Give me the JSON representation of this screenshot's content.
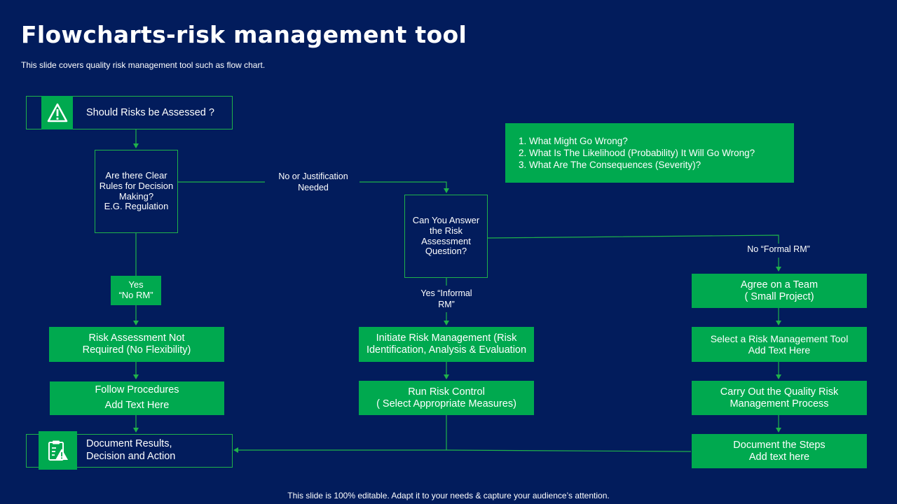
{
  "slide": {
    "title": "Flowcharts-risk management tool",
    "subtitle": "This slide covers quality risk management tool such as flow chart.",
    "footer": "This slide is 100% editable. Adapt it to your needs & capture your audience’s attention."
  },
  "flow": {
    "start": {
      "text": "Should Risks be Assessed ?",
      "icon": "warning-icon"
    },
    "rules_question": "Are there Clear\nRules for Decision\nMaking?\nE.G. Regulation",
    "no_justification_label": "No or Justification\nNeeded",
    "yes_no_rm": "Yes\n“No RM”",
    "risk_not_required": "Risk Assessment Not\nRequired (No Flexibility)",
    "follow_procedures": "Follow Procedures\nAdd Text Here",
    "document_results": {
      "text": "Document Results,\nDecision and Action",
      "icon": "clipboard-warning-icon"
    },
    "answer_question": "Can You Answer\nthe Risk\nAssessment\nQuestion?",
    "yes_informal_label": "Yes “Informal\nRM”",
    "initiate": "Initiate Risk Management (Risk\nIdentification, Analysis & Evaluation",
    "run_control": "Run Risk Control\n( Select Appropriate Measures)",
    "no_formal_label": "No “Formal RM”",
    "agree_team": "Agree on a Team\n( Small Project)",
    "select_tool": "Select a Risk Management Tool\nAdd Text Here",
    "carry_out": "Carry Out the Quality Risk\nManagement Process",
    "document_steps": "Document the Steps\nAdd text here",
    "questions": [
      "What Might Go Wrong?",
      "What Is The Likelihood (Probability) It Will Go Wrong?",
      "What Are The Consequences (Severity)?"
    ]
  },
  "colors": {
    "background": "#021c5c",
    "accent": "#00a94f",
    "connector": "#1fb24a"
  }
}
